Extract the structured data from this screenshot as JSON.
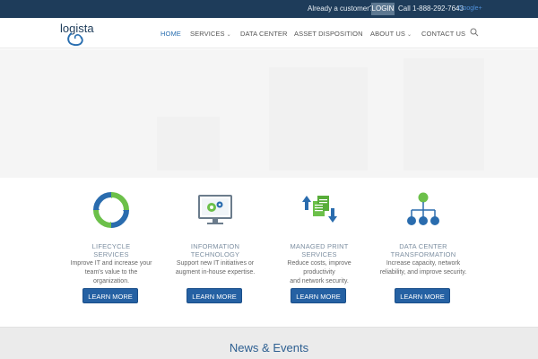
{
  "topbar": {
    "customer_text": "Already a customer?",
    "login_label": "LOGIN",
    "phone": "Call 1-888-292-7643",
    "google_plus": "Google+"
  },
  "header": {
    "logo_text": "logista",
    "nav": [
      {
        "label": "HOME",
        "active": true
      },
      {
        "label": "SERVICES",
        "dropdown": true
      },
      {
        "label": "DATA CENTER"
      },
      {
        "label": "ASSET DISPOSITION"
      },
      {
        "label": "ABOUT US",
        "dropdown": true
      },
      {
        "label": "CONTACT US"
      }
    ],
    "search_icon": "search-icon"
  },
  "services": [
    {
      "icon": "lifecycle-icon",
      "title_line1": "LIFECYCLE",
      "title_line2": "SERVICES",
      "desc_line1": "Improve IT and increase your",
      "desc_line2": "team's value to the organization.",
      "button": "LEARN MORE"
    },
    {
      "icon": "monitor-gears-icon",
      "title_line1": "INFORMATION",
      "title_line2": "TECHNOLOGY",
      "desc_line1": "Support new IT initiatives or",
      "desc_line2": "augment in-house expertise.",
      "button": "LEARN MORE"
    },
    {
      "icon": "documents-arrows-icon",
      "title_line1": "MANAGED PRINT",
      "title_line2": "SERVICES",
      "desc_line1": "Reduce costs, improve productivity",
      "desc_line2": "and network security.",
      "button": "LEARN MORE"
    },
    {
      "icon": "org-chart-icon",
      "title_line1": "DATA CENTER",
      "title_line2": "TRANSFORMATION",
      "desc_line1": "Increase capacity, network",
      "desc_line2": "reliability, and improve security.",
      "button": "LEARN MORE"
    }
  ],
  "news": {
    "title": "News & Events"
  },
  "colors": {
    "topbar": "#1e3c5a",
    "accent": "#2561a3",
    "nav_active": "#2a6fb0",
    "icon_green": "#6cc04a",
    "icon_blue": "#2a6cae"
  }
}
